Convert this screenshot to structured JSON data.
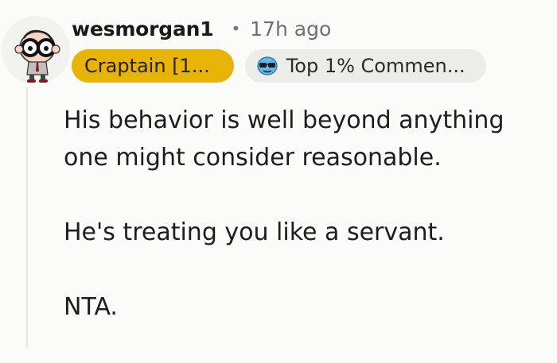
{
  "comment": {
    "author": "wesmorgan1",
    "separator": "•",
    "timestamp": "17h ago",
    "flair": "Craptain [1...",
    "award": {
      "label": "Top 1% Commen...",
      "icon": "sunglasses-emoji-icon"
    },
    "avatar_icon": "cartoon-glasses-avatar-icon",
    "body": [
      {
        "lines": [
          "His behavior is well beyond anything",
          "one might consider reasonable."
        ]
      },
      {
        "lines": [
          "He's treating you like a servant."
        ]
      },
      {
        "lines": [
          "NTA."
        ]
      }
    ]
  },
  "colors": {
    "background": "#fbfbf9",
    "flair_bg": "#e8b307",
    "award_bg": "#ecece8",
    "thread_line": "#e2e2de"
  }
}
